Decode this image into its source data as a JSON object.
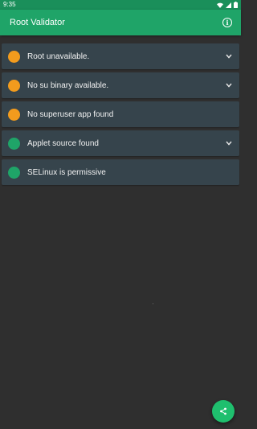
{
  "status_bar": {
    "time": "9:35",
    "icons": [
      "wifi-icon",
      "signal-icon",
      "battery-icon"
    ]
  },
  "app_bar": {
    "title": "Root Validator",
    "info_icon": "info-icon"
  },
  "checks": [
    {
      "label": "Root unavailable.",
      "status": "warning",
      "color": "#f29b1d",
      "expandable": true
    },
    {
      "label": "No su binary available.",
      "status": "warning",
      "color": "#f29b1d",
      "expandable": true
    },
    {
      "label": "No superuser app found",
      "status": "warning",
      "color": "#f29b1d",
      "expandable": false
    },
    {
      "label": "Applet source found",
      "status": "ok",
      "color": "#1fa468",
      "expandable": true
    },
    {
      "label": "SELinux is permissive",
      "status": "ok",
      "color": "#1fa468",
      "expandable": false
    }
  ],
  "fab": {
    "icon": "share-icon"
  },
  "colors": {
    "primary": "#1fa468",
    "primary_dark": "#1a8f5a",
    "accent": "#1fbf6e",
    "background": "#2f2f2f",
    "card": "#36444c",
    "warning": "#f29b1d"
  }
}
